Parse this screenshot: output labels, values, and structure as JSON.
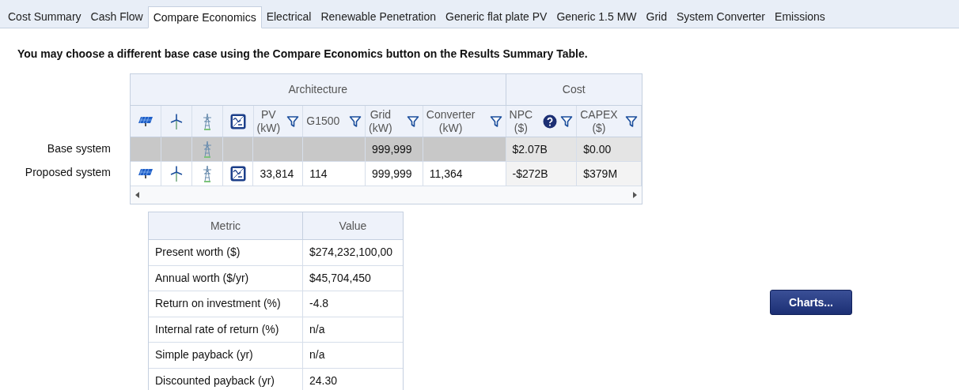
{
  "tabs": [
    {
      "label": "Cost Summary",
      "selected": false
    },
    {
      "label": "Cash Flow",
      "selected": false
    },
    {
      "label": "Compare Economics",
      "selected": true
    },
    {
      "label": "Electrical",
      "selected": false
    },
    {
      "label": "Renewable Penetration",
      "selected": false
    },
    {
      "label": "Generic flat plate PV",
      "selected": false
    },
    {
      "label": "Generic 1.5 MW",
      "selected": false
    },
    {
      "label": "Grid",
      "selected": false
    },
    {
      "label": "System Converter",
      "selected": false
    },
    {
      "label": "Emissions",
      "selected": false
    }
  ],
  "notice": "You may choose a different base case using the Compare Economics button on the Results Summary Table.",
  "comparison_table": {
    "groups": [
      {
        "label": "Architecture"
      },
      {
        "label": "Cost"
      }
    ],
    "columns": [
      {
        "label": "PV\n(kW)",
        "kind": "arch",
        "help": false
      },
      {
        "label": "G1500",
        "kind": "arch",
        "help": false
      },
      {
        "label": "Grid\n(kW)",
        "kind": "arch",
        "help": false
      },
      {
        "label": "Converter\n(kW)",
        "kind": "arch",
        "help": false
      },
      {
        "label": "NPC\n($)",
        "kind": "cost",
        "help": true
      },
      {
        "label": "CAPEX\n($)",
        "kind": "cost",
        "help": false
      }
    ],
    "rows": [
      {
        "label": "Base system",
        "selected": true,
        "components": {
          "pv": false,
          "wind": false,
          "grid": true,
          "converter": false
        },
        "cells": [
          null,
          null,
          "999,999",
          null,
          "$2.07B",
          "$0.00"
        ]
      },
      {
        "label": "Proposed system",
        "selected": false,
        "components": {
          "pv": true,
          "wind": true,
          "grid": true,
          "converter": true
        },
        "cells": [
          "33,814",
          "114",
          "999,999",
          "11,364",
          "-$272B",
          "$379M"
        ]
      }
    ]
  },
  "metrics_table": {
    "columns": [
      "Metric",
      "Value"
    ],
    "rows": [
      [
        "Present worth ($)",
        "$274,232,100,00"
      ],
      [
        "Annual worth ($/yr)",
        "$45,704,450"
      ],
      [
        "Return on investment (%)",
        "-4.8"
      ],
      [
        "Internal rate of return (%)",
        "n/a"
      ],
      [
        "Simple payback (yr)",
        "n/a"
      ],
      [
        "Discounted payback (yr)",
        "24.30"
      ]
    ]
  },
  "charts_button": "Charts..."
}
